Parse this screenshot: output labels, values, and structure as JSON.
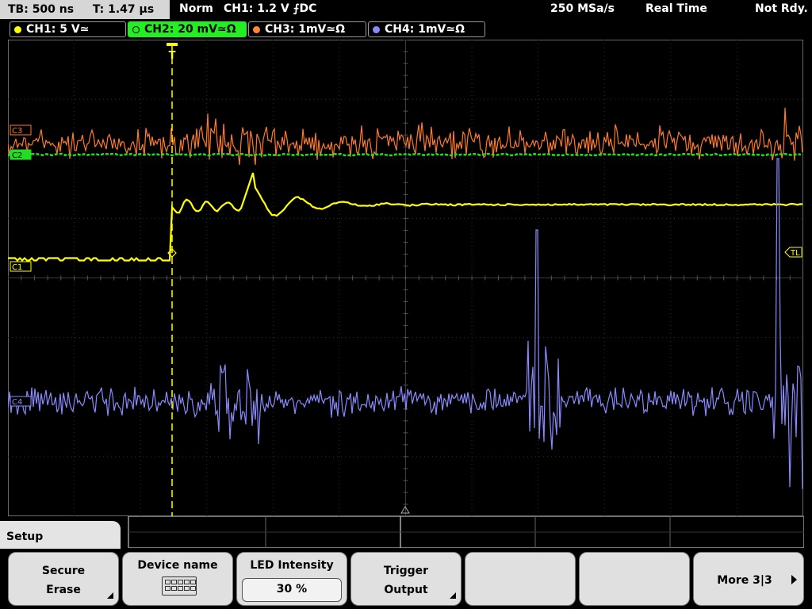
{
  "status_bar": {
    "timebase": "TB: 500 ns",
    "trigger_time": "T: 1.47 µs",
    "trigger_mode": "Norm",
    "trigger_setting": "CH1: 1.2 V ⨍DC",
    "sample_rate": "250 MSa/s",
    "acquisition_mode": "Real Time",
    "status": "Not Rdy."
  },
  "channels": [
    {
      "label": "CH1: 5 V≃",
      "color": "#ffff00",
      "active": false
    },
    {
      "label": "CH2: 20 mV≃Ω",
      "color": "#00ff00",
      "active": true
    },
    {
      "label": "CH3: 1mV≃Ω",
      "color": "#ff8833",
      "active": false
    },
    {
      "label": "CH4: 1mV≃Ω",
      "color": "#8888ff",
      "active": false
    }
  ],
  "markers": {
    "ch1": "C1",
    "ch2": "C2",
    "ch3": "C3",
    "ch4": "C4",
    "trigger_level": "TL",
    "trigger_position": "T"
  },
  "colors": {
    "ch1": "#ffff00",
    "ch2": "#22dd22",
    "ch3": "#ff7a2a",
    "ch4": "#8a8aff",
    "grid": "#3a3a3a",
    "menu_bg": "#e0e0e0"
  },
  "menu": {
    "title": "Setup",
    "softkeys": [
      {
        "line1": "Secure",
        "line2": "Erase",
        "submenu": true
      },
      {
        "line1": "Device name",
        "icon": "keyboard-icon"
      },
      {
        "line1": "LED Intensity",
        "value": "30 %"
      },
      {
        "line1": "Trigger",
        "line2": "Output",
        "submenu": true
      },
      {
        "line1": ""
      },
      {
        "line1": ""
      },
      {
        "line1": "More 3|3",
        "icon": "next-arrow-icon"
      }
    ]
  }
}
